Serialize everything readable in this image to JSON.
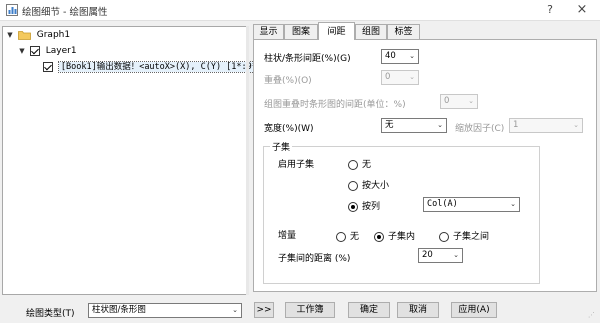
{
  "window": {
    "title": "绘图细节 - 绘图属性",
    "help": "?",
    "close": "×"
  },
  "tree": {
    "graph": "Graph1",
    "layer": "Layer1",
    "plot": "[Book1]输出数据！<autoX>(X), C(Y) [1*:9*]"
  },
  "tabs": [
    {
      "label": "显示"
    },
    {
      "label": "图案"
    },
    {
      "label": "间距"
    },
    {
      "label": "组图"
    },
    {
      "label": "标签"
    }
  ],
  "spacing": {
    "gap_label": "柱状/条形间距(%)(G)",
    "gap_value": "40",
    "overlap_label": "重叠(%)(O)",
    "overlap_value": "0",
    "group_gap_label": "组图重叠时条形图的间距(单位：%)",
    "group_gap_value": "0",
    "width_label": "宽度(%)(W)",
    "width_value": "无",
    "scale_label": "缩放因子(C)",
    "scale_value": "1"
  },
  "subset": {
    "title": "子集",
    "enable_label": "启用子集",
    "opt_none": "无",
    "opt_size": "按大小",
    "opt_column": "按列",
    "column_value": "Col(A)",
    "increment_label": "增量",
    "inc_none": "无",
    "inc_within": "子集内",
    "inc_between": "子集之间",
    "distance_label": "子集间的距离 (%)",
    "distance_value": "20"
  },
  "bottom": {
    "plot_type_label": "绘图类型(T)",
    "plot_type_value": "柱状图/条形图",
    "expand": ">>",
    "workbook": "工作簿",
    "ok": "确定",
    "cancel": "取消",
    "apply": "应用(A)"
  }
}
